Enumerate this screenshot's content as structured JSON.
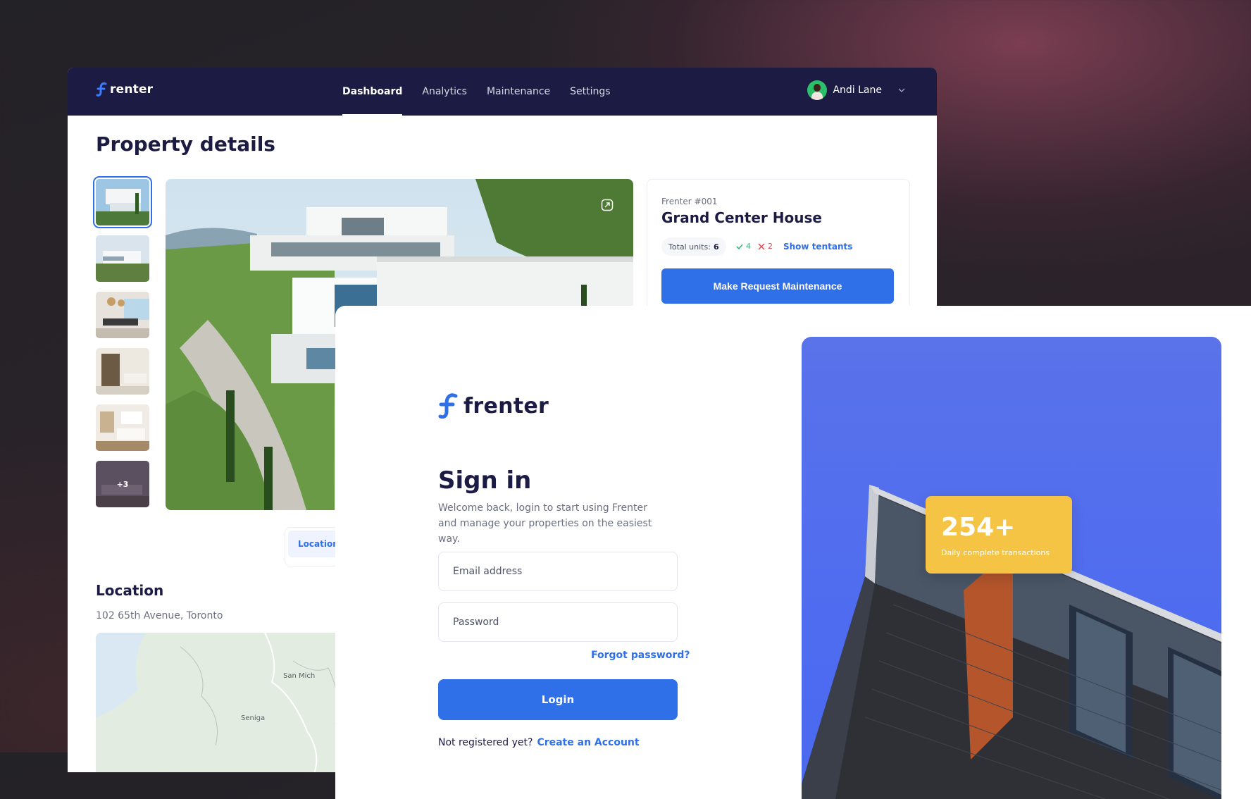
{
  "dashboard": {
    "brand": "renter",
    "nav": [
      {
        "label": "Dashboard",
        "active": true
      },
      {
        "label": "Analytics",
        "active": false
      },
      {
        "label": "Maintenance",
        "active": false
      },
      {
        "label": "Settings",
        "active": false
      }
    ],
    "user": {
      "name": "Andi Lane"
    },
    "page_title": "Property details",
    "gallery": {
      "more_count": "+3"
    },
    "property": {
      "code": "Frenter #001",
      "name": "Grand Center House",
      "total_units_label": "Total units:",
      "total_units": "6",
      "occupied": "4",
      "vacant": "2",
      "show_tenants": "Show tentants",
      "maintenance_button": "Make Request Maintenance"
    },
    "tabs": {
      "active": "Location"
    },
    "location": {
      "title": "Location",
      "address": "102 65th Avenue, Toronto",
      "map_labels": [
        "San Mich",
        "Seniga"
      ]
    }
  },
  "signin": {
    "brand": "frenter",
    "title": "Sign in",
    "subtitle": "Welcome back, login to start using Frenter and manage your properties on the easiest way.",
    "email_placeholder": "Email address",
    "password_placeholder": "Password",
    "forgot": "Forgot password?",
    "login_button": "Login",
    "not_registered": "Not registered yet?",
    "create_account": "Create an Account",
    "stat": {
      "value": "254+",
      "label": "Daily complete transactions"
    }
  },
  "colors": {
    "navy": "#1c1b43",
    "primary": "#2f6fe8",
    "success": "#2bb673",
    "danger": "#e5484d",
    "stat_card": "#f5c445",
    "hero_blue": "#4e6cf0"
  }
}
